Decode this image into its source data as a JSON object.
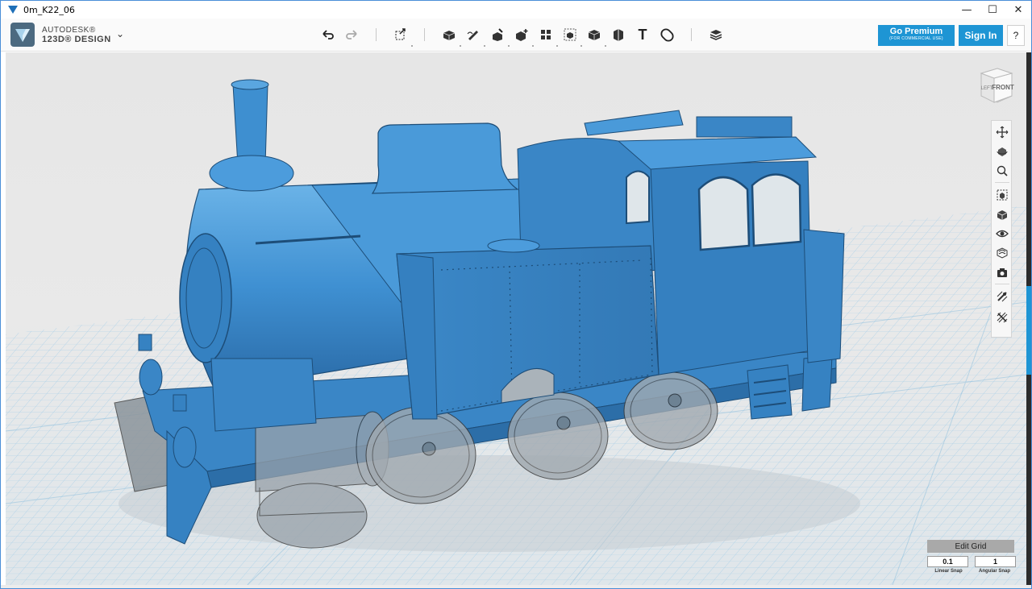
{
  "window": {
    "title": "0m_K22_06",
    "minimize": "—",
    "maximize": "☐",
    "close": "✕"
  },
  "brand": {
    "line1": "AUTODESK®",
    "line2": "123D® DESIGN",
    "menu_chevron": "⌄"
  },
  "toolbar": {
    "undo_label": "Undo",
    "redo_label": "Redo",
    "tools": [
      "transform-icon",
      "primitives-icon",
      "sketch-icon",
      "construct-icon",
      "modify-icon",
      "pattern-icon",
      "group-icon",
      "combine-icon",
      "measure-icon",
      "material-icon",
      "text-icon",
      "snap-icon",
      "layers-icon"
    ],
    "text_tool_glyph": "T"
  },
  "account": {
    "premium_label": "Go Premium",
    "premium_sub": "(FOR COMMERCIAL USE)",
    "signin_label": "Sign In",
    "help_label": "?"
  },
  "viewcube": {
    "front_label": "FRONT",
    "left_label": "LEFT"
  },
  "nav": {
    "buttons": [
      "pan-icon",
      "orbit-icon",
      "zoom-icon",
      "fit-icon",
      "view-icon",
      "visibility-icon",
      "materials-icon",
      "camera-icon",
      "snap-toggle-icon",
      "grid-toggle-icon"
    ]
  },
  "grid": {
    "edit_label": "Edit Grid",
    "linear_value": "0.1",
    "angular_value": "1",
    "linear_label": "Linear Snap",
    "angular_label": "Angular Snap"
  },
  "colors": {
    "model_blue": "#3d8ccf",
    "model_shadow": "#2c6ea8",
    "ghost_part": "#9aa3ab",
    "grid_line": "#a9cfe8",
    "accent": "#1e95d4"
  }
}
